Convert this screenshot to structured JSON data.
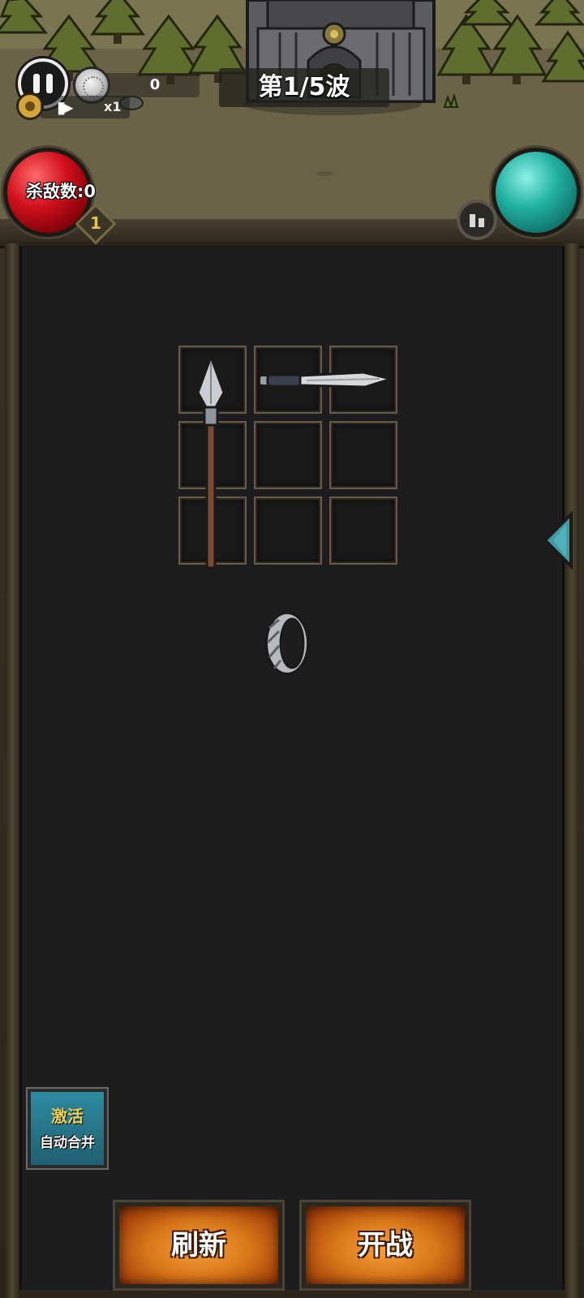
{
  "hud": {
    "coins": "0",
    "speed": "x1",
    "wave": "第1/5波",
    "kills": "杀敌数:0",
    "level": "1"
  },
  "inventory": {
    "rows": 3,
    "cols": 3,
    "items": [
      "spear",
      "knife",
      "ring"
    ]
  },
  "buttons": {
    "auto_merge_top": "激活",
    "auto_merge_bottom": "自动合并",
    "refresh": "刷新",
    "battle": "开战"
  },
  "colors": {
    "health_orb": "#d0101c",
    "mana_orb": "#22b2a3",
    "action_button": "#d9771a",
    "merge_button": "#2f8aa0"
  }
}
